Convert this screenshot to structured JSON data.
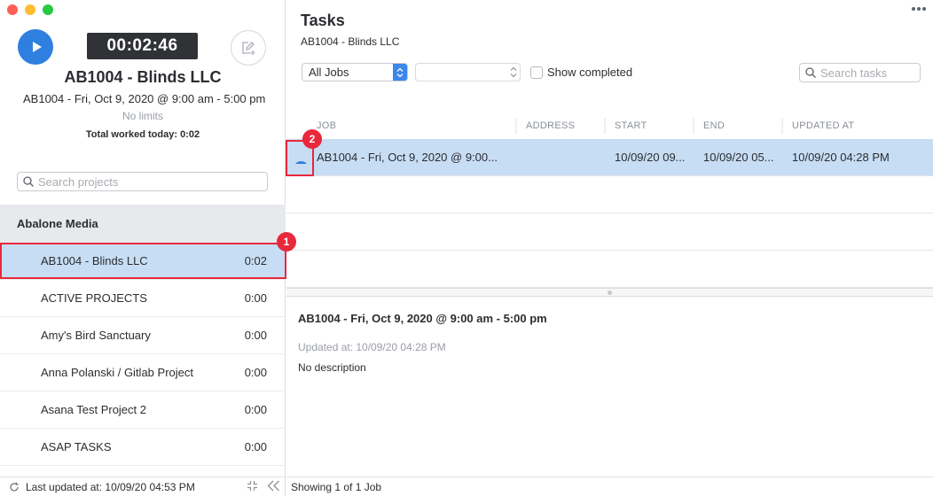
{
  "window": {
    "controls": [
      "close",
      "minimize",
      "maximize"
    ]
  },
  "timer_panel": {
    "play_icon": "play-icon",
    "elapsed": "00:02:46",
    "edit_icon": "edit-add-icon",
    "project_title": "AB1004 - Blinds LLC",
    "task_line": "AB1004 - Fri, Oct 9, 2020 @ 9:00 am - 5:00 pm",
    "limits": "No limits",
    "total_worked_label": "Total worked today:",
    "total_worked_value": "0:02"
  },
  "sidebar": {
    "search_placeholder": "Search projects",
    "group": "Abalone Media",
    "projects": [
      {
        "name": "AB1004 - Blinds LLC",
        "time": "0:02",
        "selected": true
      },
      {
        "name": "ACTIVE PROJECTS",
        "time": "0:00"
      },
      {
        "name": "Amy's Bird Sanctuary",
        "time": "0:00"
      },
      {
        "name": "Anna Polanski / Gitlab Project",
        "time": "0:00"
      },
      {
        "name": "Asana Test Project 2",
        "time": "0:00"
      },
      {
        "name": "ASAP TASKS",
        "time": "0:00"
      }
    ],
    "footer": {
      "last_updated": "Last updated at: 10/09/20 04:53 PM",
      "refresh_icon": "refresh-icon",
      "compact_icon": "compress-icon",
      "collapse_icon": "double-chevron-left-icon"
    }
  },
  "main": {
    "title": "Tasks",
    "subtitle": "AB1004 - Blinds LLC",
    "more_icon": "more-horizontal-icon",
    "filters": {
      "jobs_select": "All Jobs",
      "second_select": "",
      "show_completed_label": "Show completed",
      "show_completed_checked": false,
      "search_placeholder": "Search tasks"
    },
    "table": {
      "columns": [
        "JOB",
        "ADDRESS",
        "START",
        "END",
        "UPDATED AT"
      ],
      "rows": [
        {
          "job": "AB1004 - Fri, Oct 9, 2020 @ 9:00...",
          "address": "",
          "start": "10/09/20 09...",
          "end": "10/09/20 05...",
          "updated_at": "10/09/20 04:28 PM",
          "selected": true
        }
      ]
    },
    "detail": {
      "title": "AB1004 - Fri, Oct 9, 2020 @ 9:00 am - 5:00 pm",
      "updated": "Updated at: 10/09/20 04:28 PM",
      "description": "No description"
    },
    "footer": {
      "status": "Showing 1 of 1 Job"
    }
  },
  "annotations": [
    {
      "label": "1",
      "color": "#e8283c"
    },
    {
      "label": "2",
      "color": "#e8283c"
    }
  ]
}
